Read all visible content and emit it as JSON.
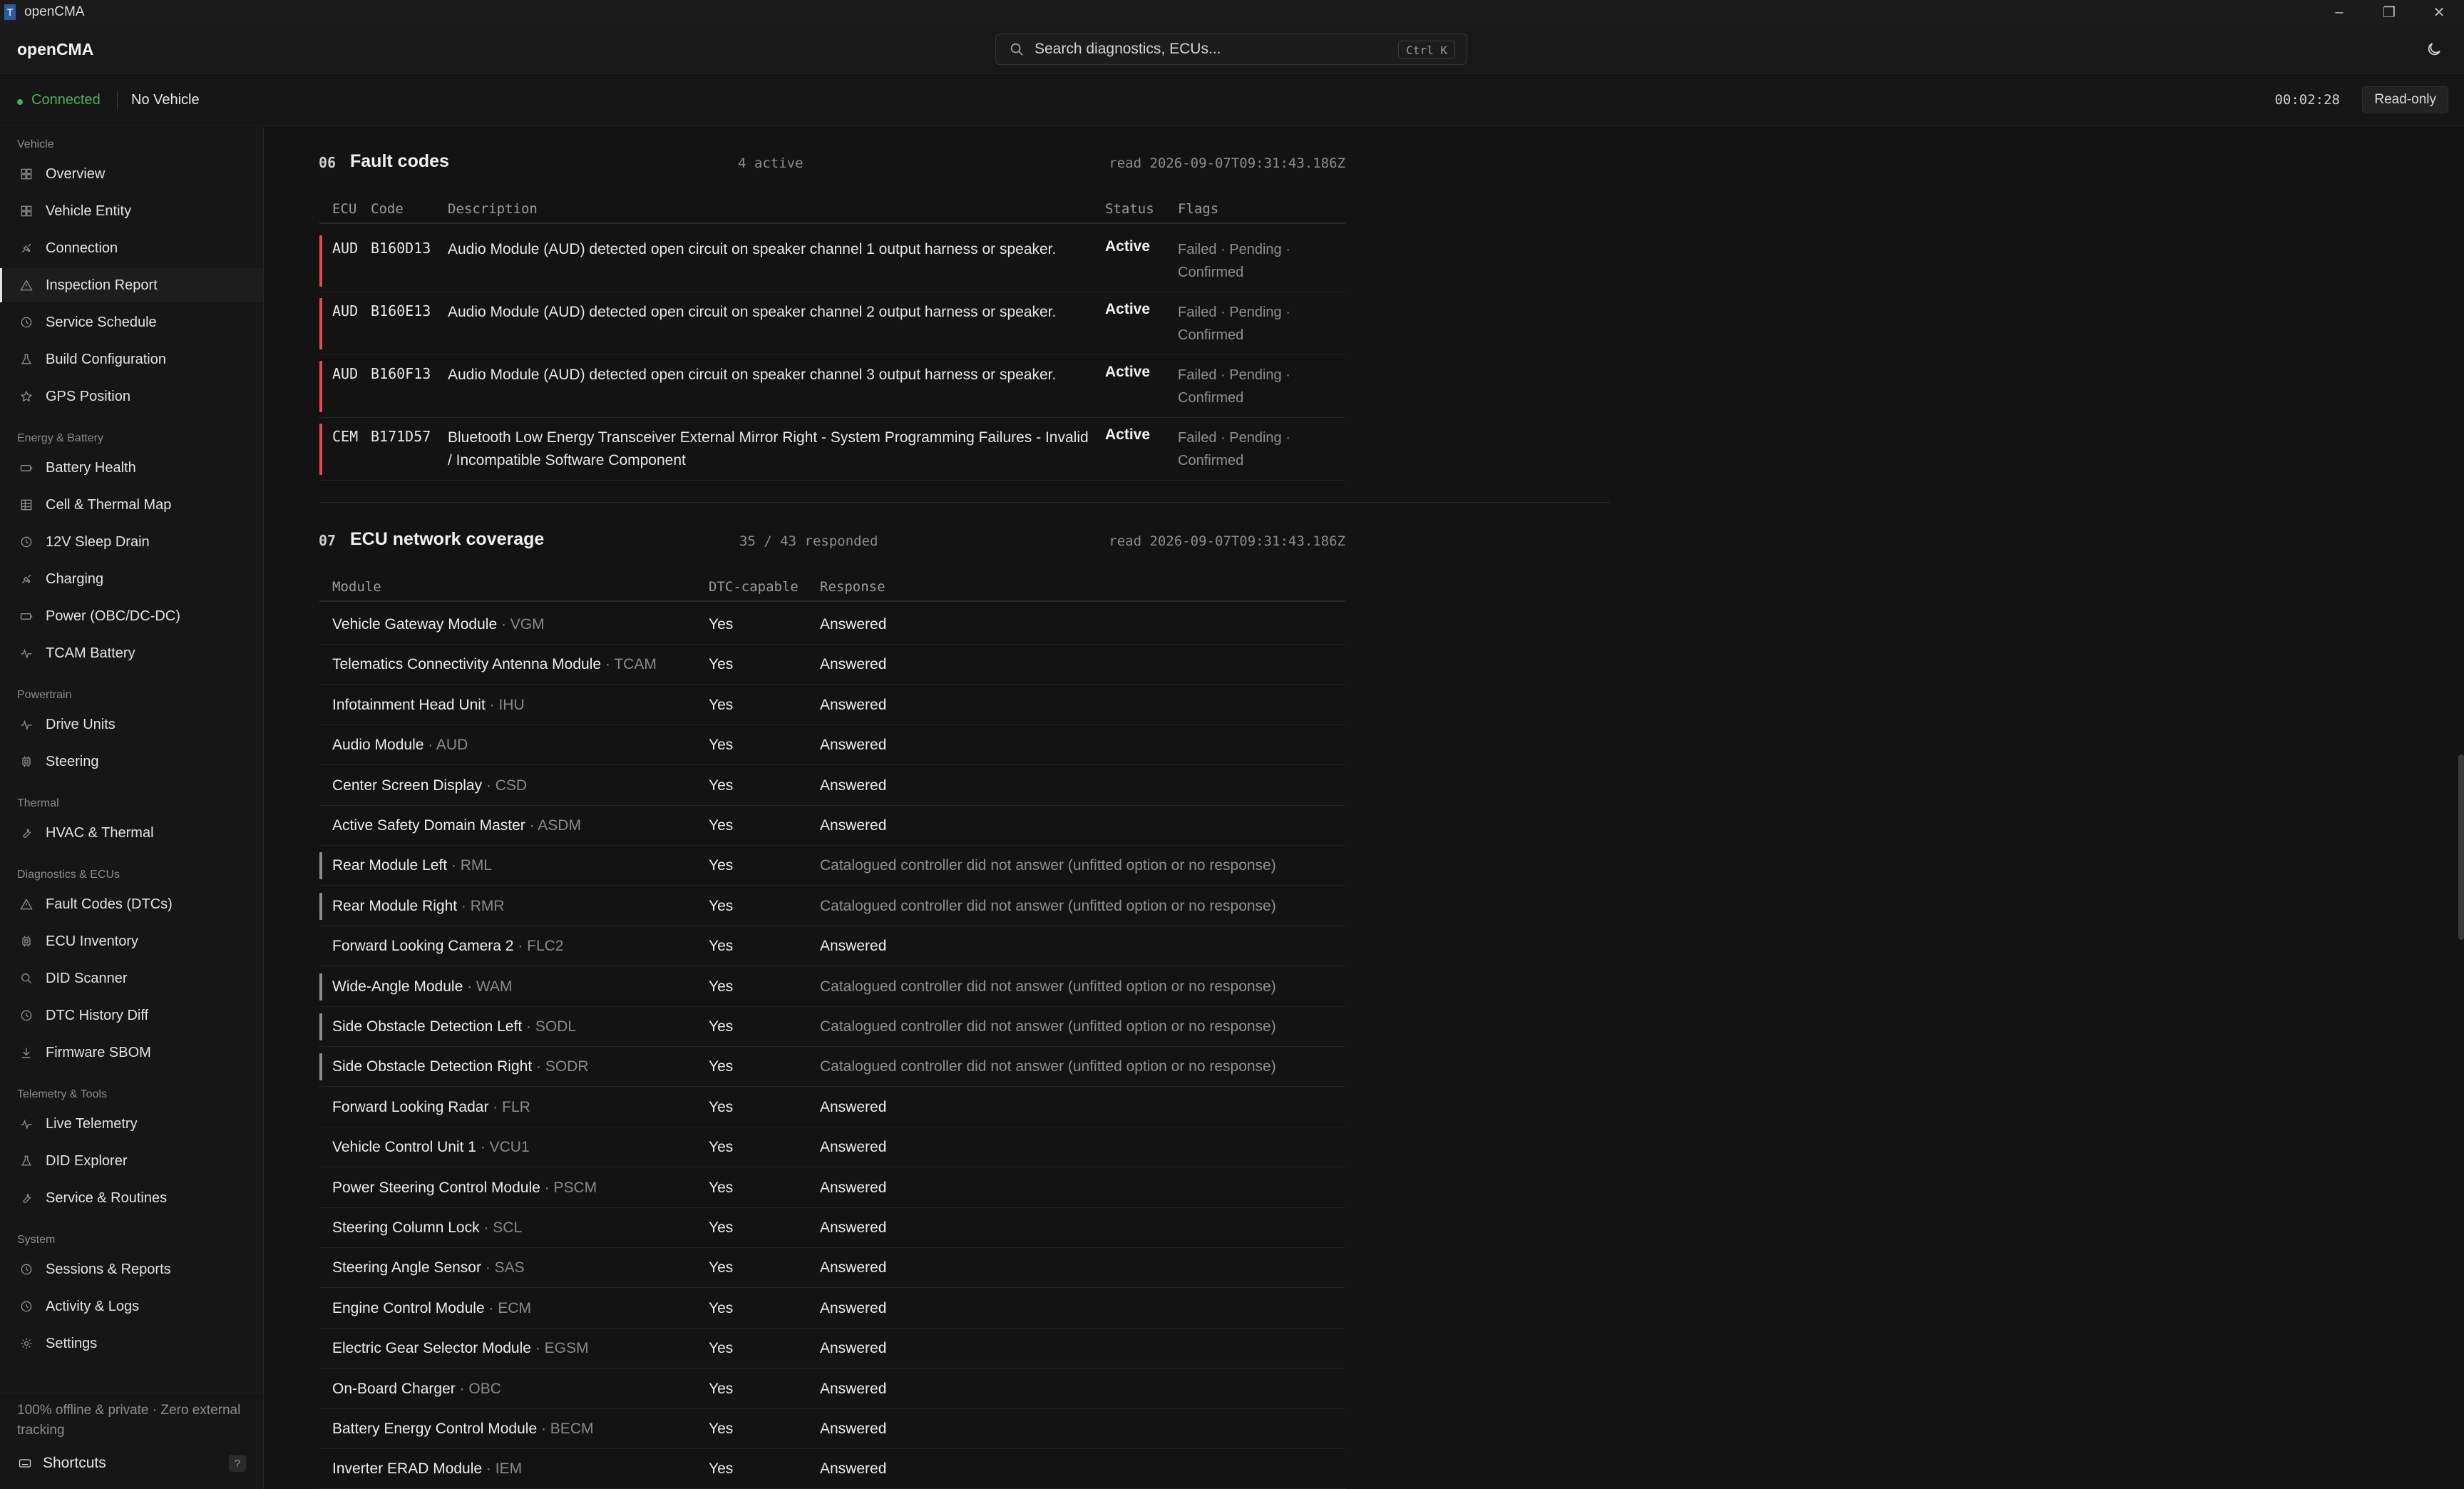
{
  "window": {
    "title": "openCMA"
  },
  "header": {
    "brand": "openCMA",
    "search_placeholder": "Search diagnostics, ECUs...",
    "search_shortcut": "Ctrl K"
  },
  "status": {
    "connection": "Connected",
    "vehicle": "No Vehicle",
    "timer": "00:02:28",
    "mode": "Read-only"
  },
  "sidebar": {
    "groups": [
      {
        "label": "Vehicle",
        "items": [
          {
            "label": "Overview",
            "icon": "grid-icon"
          },
          {
            "label": "Vehicle Entity",
            "icon": "grid-icon"
          },
          {
            "label": "Connection",
            "icon": "plug-icon"
          },
          {
            "label": "Inspection Report",
            "icon": "warning-icon",
            "active": true
          },
          {
            "label": "Service Schedule",
            "icon": "clock-icon"
          },
          {
            "label": "Build Configuration",
            "icon": "flask-icon"
          },
          {
            "label": "GPS Position",
            "icon": "star-icon"
          }
        ]
      },
      {
        "label": "Energy & Battery",
        "items": [
          {
            "label": "Battery Health",
            "icon": "battery-icon"
          },
          {
            "label": "Cell & Thermal Map",
            "icon": "table-icon"
          },
          {
            "label": "12V Sleep Drain",
            "icon": "clock-icon"
          },
          {
            "label": "Charging",
            "icon": "plug-icon"
          },
          {
            "label": "Power (OBC/DC-DC)",
            "icon": "battery-icon"
          },
          {
            "label": "TCAM Battery",
            "icon": "pulse-icon"
          }
        ]
      },
      {
        "label": "Powertrain",
        "items": [
          {
            "label": "Drive Units",
            "icon": "pulse-icon"
          },
          {
            "label": "Steering",
            "icon": "chip-icon"
          }
        ]
      },
      {
        "label": "Thermal",
        "items": [
          {
            "label": "HVAC & Thermal",
            "icon": "wrench-icon"
          }
        ]
      },
      {
        "label": "Diagnostics & ECUs",
        "items": [
          {
            "label": "Fault Codes (DTCs)",
            "icon": "warning-icon"
          },
          {
            "label": "ECU Inventory",
            "icon": "chip-icon"
          },
          {
            "label": "DID Scanner",
            "icon": "search-icon"
          },
          {
            "label": "DTC History Diff",
            "icon": "clock-icon"
          },
          {
            "label": "Firmware SBOM",
            "icon": "download-icon"
          }
        ]
      },
      {
        "label": "Telemetry & Tools",
        "items": [
          {
            "label": "Live Telemetry",
            "icon": "pulse-icon"
          },
          {
            "label": "DID Explorer",
            "icon": "flask-icon"
          },
          {
            "label": "Service & Routines",
            "icon": "wrench-icon"
          }
        ]
      },
      {
        "label": "System",
        "items": [
          {
            "label": "Sessions & Reports",
            "icon": "clock-icon"
          },
          {
            "label": "Activity & Logs",
            "icon": "clock-icon"
          },
          {
            "label": "Settings",
            "icon": "gear-icon"
          }
        ]
      }
    ],
    "footer_note": "100% offline & private · Zero external tracking",
    "shortcuts_label": "Shortcuts",
    "shortcuts_key": "?"
  },
  "faults": {
    "number": "06",
    "title": "Fault codes",
    "count": "4 active",
    "read": "read 2026-09-07T09:31:43.186Z",
    "columns": {
      "ecu": "ECU",
      "code": "Code",
      "description": "Description",
      "status": "Status",
      "flags": "Flags"
    },
    "rows": [
      {
        "ecu": "AUD",
        "code": "B160D13",
        "description": "Audio Module (AUD) detected open circuit on speaker channel 1 output harness or speaker.",
        "status": "Active",
        "flags": "Failed · Pending · Confirmed"
      },
      {
        "ecu": "AUD",
        "code": "B160E13",
        "description": "Audio Module (AUD) detected open circuit on speaker channel 2 output harness or speaker.",
        "status": "Active",
        "flags": "Failed · Pending · Confirmed"
      },
      {
        "ecu": "AUD",
        "code": "B160F13",
        "description": "Audio Module (AUD) detected open circuit on speaker channel 3 output harness or speaker.",
        "status": "Active",
        "flags": "Failed · Pending · Confirmed"
      },
      {
        "ecu": "CEM",
        "code": "B171D57",
        "description": "Bluetooth Low Energy Transceiver External Mirror Right - System Programming Failures - Invalid / Incompatible Software Component",
        "status": "Active",
        "flags": "Failed · Pending · Confirmed"
      }
    ]
  },
  "coverage": {
    "number": "07",
    "title": "ECU network coverage",
    "count": "35 / 43 responded",
    "read": "read 2026-09-07T09:31:43.186Z",
    "columns": {
      "module": "Module",
      "dtc": "DTC-capable",
      "response": "Response"
    },
    "rows": [
      {
        "module": "Vehicle Gateway Module",
        "abbr": " · VGM",
        "dtc": "Yes",
        "response": "Answered",
        "answered": true
      },
      {
        "module": "Telematics Connectivity Antenna Module",
        "abbr": " · TCAM",
        "dtc": "Yes",
        "response": "Answered",
        "answered": true
      },
      {
        "module": "Infotainment Head Unit",
        "abbr": " · IHU",
        "dtc": "Yes",
        "response": "Answered",
        "answered": true
      },
      {
        "module": "Audio Module",
        "abbr": " · AUD",
        "dtc": "Yes",
        "response": "Answered",
        "answered": true
      },
      {
        "module": "Center Screen Display",
        "abbr": " · CSD",
        "dtc": "Yes",
        "response": "Answered",
        "answered": true
      },
      {
        "module": "Active Safety Domain Master",
        "abbr": " · ASDM",
        "dtc": "Yes",
        "response": "Answered",
        "answered": true
      },
      {
        "module": "Rear Module Left",
        "abbr": " · RML",
        "dtc": "Yes",
        "response": "Catalogued controller did not answer (unfitted option or no response)",
        "answered": false
      },
      {
        "module": "Rear Module Right",
        "abbr": " · RMR",
        "dtc": "Yes",
        "response": "Catalogued controller did not answer (unfitted option or no response)",
        "answered": false
      },
      {
        "module": "Forward Looking Camera 2",
        "abbr": " · FLC2",
        "dtc": "Yes",
        "response": "Answered",
        "answered": true
      },
      {
        "module": "Wide-Angle Module",
        "abbr": " · WAM",
        "dtc": "Yes",
        "response": "Catalogued controller did not answer (unfitted option or no response)",
        "answered": false
      },
      {
        "module": "Side Obstacle Detection Left",
        "abbr": " · SODL",
        "dtc": "Yes",
        "response": "Catalogued controller did not answer (unfitted option or no response)",
        "answered": false
      },
      {
        "module": "Side Obstacle Detection Right",
        "abbr": " · SODR",
        "dtc": "Yes",
        "response": "Catalogued controller did not answer (unfitted option or no response)",
        "answered": false
      },
      {
        "module": "Forward Looking Radar",
        "abbr": " · FLR",
        "dtc": "Yes",
        "response": "Answered",
        "answered": true
      },
      {
        "module": "Vehicle Control Unit 1",
        "abbr": " · VCU1",
        "dtc": "Yes",
        "response": "Answered",
        "answered": true
      },
      {
        "module": "Power Steering Control Module",
        "abbr": " · PSCM",
        "dtc": "Yes",
        "response": "Answered",
        "answered": true
      },
      {
        "module": "Steering Column Lock",
        "abbr": " · SCL",
        "dtc": "Yes",
        "response": "Answered",
        "answered": true
      },
      {
        "module": "Steering Angle Sensor",
        "abbr": " · SAS",
        "dtc": "Yes",
        "response": "Answered",
        "answered": true
      },
      {
        "module": "Engine Control Module",
        "abbr": " · ECM",
        "dtc": "Yes",
        "response": "Answered",
        "answered": true
      },
      {
        "module": "Electric Gear Selector Module",
        "abbr": " · EGSM",
        "dtc": "Yes",
        "response": "Answered",
        "answered": true
      },
      {
        "module": "On-Board Charger",
        "abbr": " · OBC",
        "dtc": "Yes",
        "response": "Answered",
        "answered": true
      },
      {
        "module": "Battery Energy Control Module",
        "abbr": " · BECM",
        "dtc": "Yes",
        "response": "Answered",
        "answered": true
      },
      {
        "module": "Inverter ERAD Module",
        "abbr": " · IEM",
        "dtc": "Yes",
        "response": "Answered",
        "answered": true
      }
    ]
  },
  "colors": {
    "accent_ok": "#4caf50",
    "fault_bar": "#e5484d",
    "muted": "#8a8a8a"
  }
}
